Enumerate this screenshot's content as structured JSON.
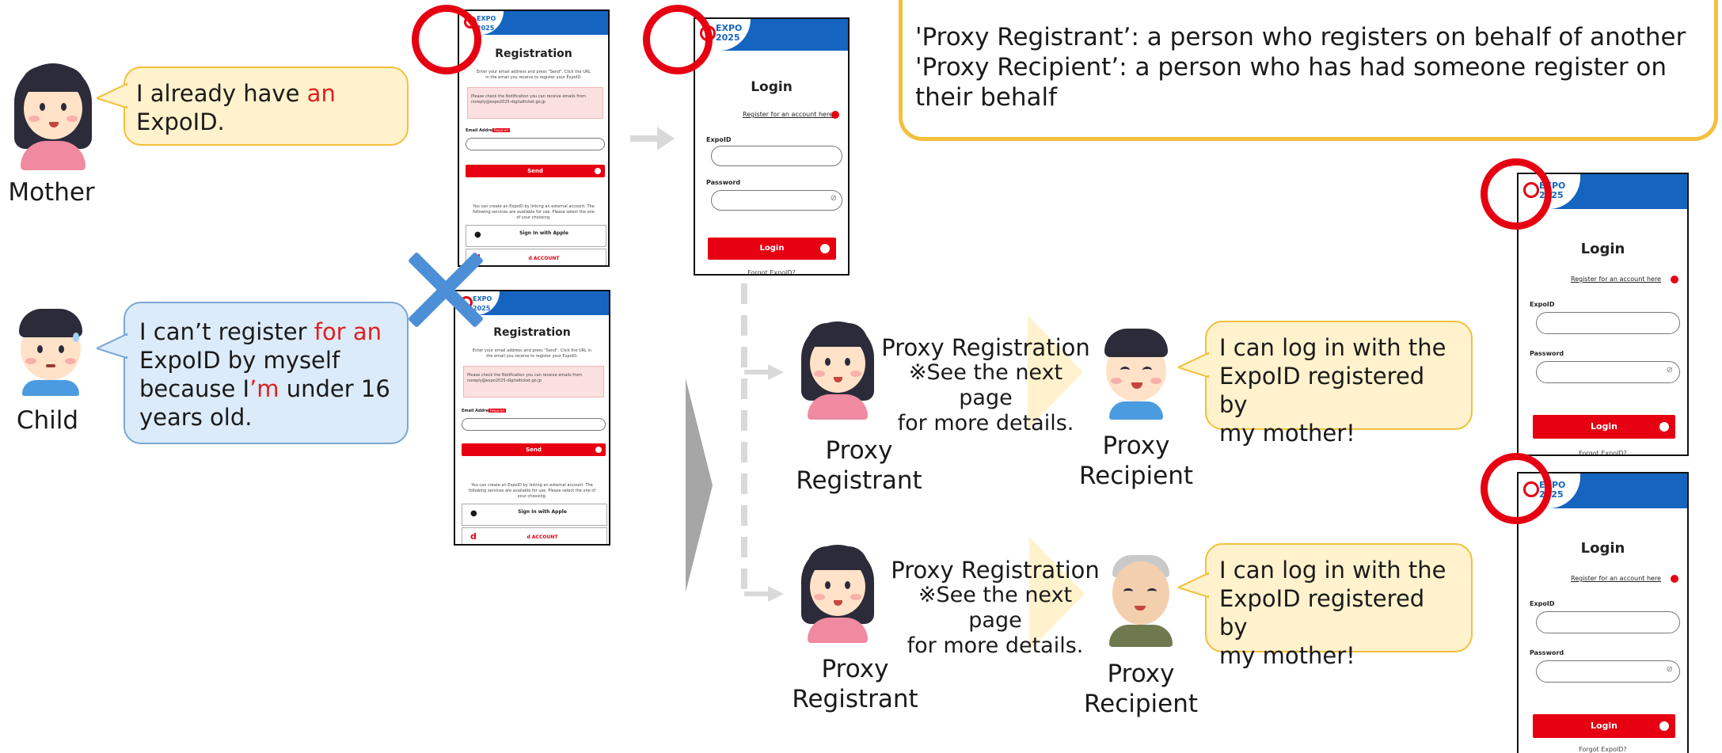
{
  "definitions": {
    "line1": "'Proxy Registrant’: a person who registers on behalf of another",
    "line2": "'Proxy Recipient’: a person who has had someone register on",
    "line3": "their behalf"
  },
  "mother": {
    "label": "Mother",
    "speech_a": "I already have ",
    "speech_b": "an",
    "speech_c": "ExpoID."
  },
  "child": {
    "label": "Child",
    "speech_a": "I can’t register ",
    "speech_b": "for an",
    "speech_c": "ExpoID by myself",
    "speech_d": "because I",
    "speech_e": "’m",
    "speech_f": " under 16",
    "speech_g": "years old."
  },
  "registration_screen": {
    "title": "Registration",
    "instructions": "Enter your email address and press \"Send\". Click the URL in the email you receive to register your ExpoID.",
    "notice": "Please check the Notification you can receive emails from noreply@expo2025-digitalticket.go.jp",
    "email_label": "Email Address",
    "required": "Required",
    "send_button": "Send",
    "sso_note": "You can create an ExpoID by linking an external account. The following services are available for use. Please select the one of your choosing.",
    "apple_label": "Sign In with Apple",
    "daccount_label": "d ACCOUNT"
  },
  "login_screen": {
    "logo_line1": "EXPO",
    "logo_line2": "2025",
    "title": "Login",
    "register_link": "Register for an account here",
    "expoid_label": "ExpoID",
    "password_label": "Password",
    "login_button": "Login",
    "forgot": "Forgot ExpoID?"
  },
  "proxy_rows": [
    {
      "registrant_label_1": "Proxy",
      "registrant_label_2": "Registrant",
      "title": "Proxy Registration",
      "note_1": "※See the next page",
      "note_2": "for more details.",
      "recipient_label_1": "Proxy",
      "recipient_label_2": "Recipient",
      "speech_1": "I can log in with the",
      "speech_2": "ExpoID registered by",
      "speech_3": "my mother!"
    },
    {
      "registrant_label_1": "Proxy",
      "registrant_label_2": "Registrant",
      "title": "Proxy Registration",
      "note_1": "※See the next page",
      "note_2": "for more details.",
      "recipient_label_1": "Proxy",
      "recipient_label_2": "Recipient",
      "speech_1": "I can log in with the",
      "speech_2": "ExpoID registered by",
      "speech_3": "my mother!"
    }
  ],
  "colors": {
    "accent_red": "#e60012",
    "expo_blue": "#1565c0",
    "bubble_yellow": "#fff2cc",
    "bubble_blue": "#dcebf9",
    "cross_blue": "#4d8fd6"
  }
}
